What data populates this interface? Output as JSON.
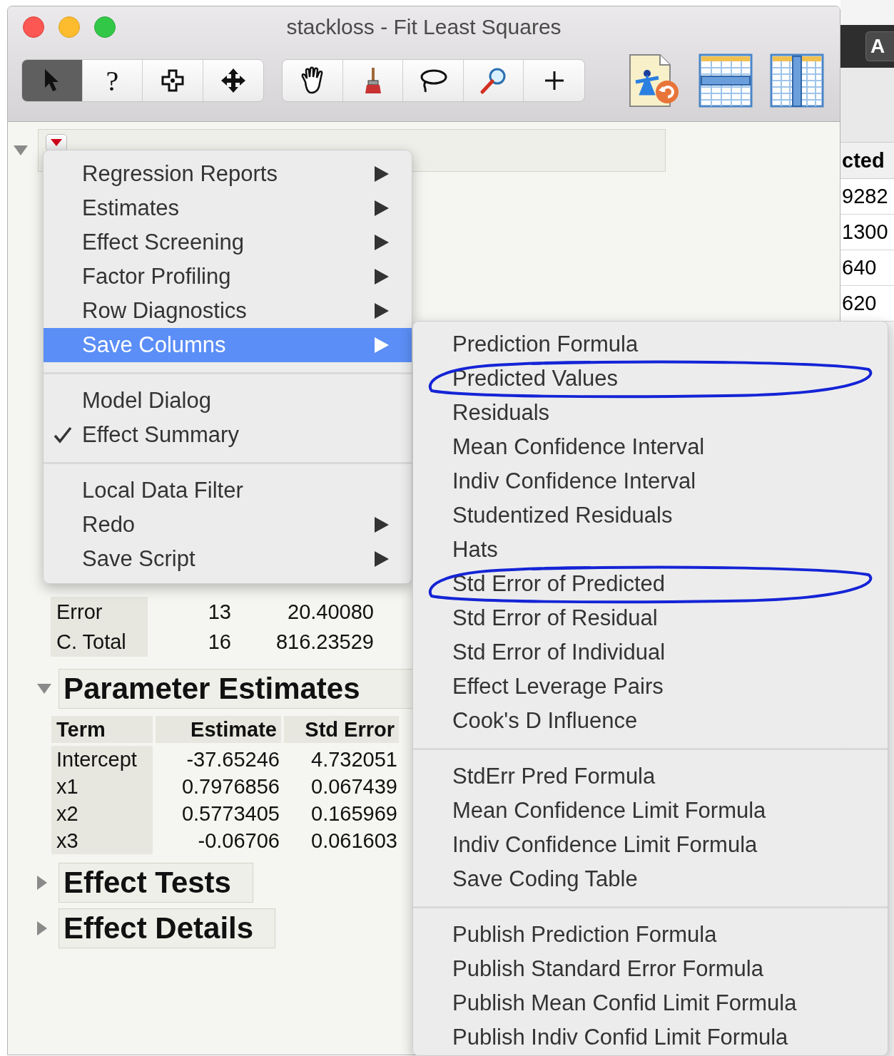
{
  "window": {
    "title": "stackloss - Fit Least Squares"
  },
  "toolbar": {
    "tool_groups": [
      {
        "tools": [
          {
            "kind": "arrow",
            "selected": true
          },
          {
            "kind": "help",
            "label": "?",
            "selected": false
          },
          {
            "kind": "crosshair",
            "selected": false
          },
          {
            "kind": "move",
            "selected": false
          }
        ]
      },
      {
        "tools": [
          {
            "kind": "hand",
            "selected": false
          },
          {
            "kind": "brush",
            "selected": false
          },
          {
            "kind": "lasso",
            "selected": false
          },
          {
            "kind": "magnifier",
            "selected": false
          },
          {
            "kind": "plus-cursor",
            "selected": false
          }
        ]
      }
    ],
    "big_buttons": [
      {
        "kind": "file"
      },
      {
        "kind": "row-table"
      },
      {
        "kind": "column-table"
      }
    ]
  },
  "report": {
    "expanded": true,
    "analysis_rows": [
      {
        "column_1": "Error",
        "column_2": "13",
        "column_3": "20.40080"
      },
      {
        "column_1": "C. Total",
        "column_2": "16",
        "column_3": "816.23529"
      }
    ],
    "sections": [
      {
        "title": "Parameter Estimates",
        "expanded": true,
        "table": {
          "columns": [
            "Term",
            "Estimate",
            "Std Error"
          ],
          "rows": [
            [
              "Intercept",
              "-37.65246",
              "4.732051"
            ],
            [
              "x1",
              "0.7976856",
              "0.067439"
            ],
            [
              "x2",
              "0.5773405",
              "0.165969"
            ],
            [
              "x3",
              "-0.06706",
              "0.061603"
            ]
          ]
        }
      },
      {
        "title": "Effect Tests",
        "expanded": false
      },
      {
        "title": "Effect Details",
        "expanded": false
      }
    ]
  },
  "menu": {
    "groups": [
      {
        "items": [
          {
            "label": "Regression Reports",
            "has_submenu": true,
            "checked": false,
            "selected": false
          },
          {
            "label": "Estimates",
            "has_submenu": true,
            "checked": false,
            "selected": false
          },
          {
            "label": "Effect Screening",
            "has_submenu": true,
            "checked": false,
            "selected": false
          },
          {
            "label": "Factor Profiling",
            "has_submenu": true,
            "checked": false,
            "selected": false
          },
          {
            "label": "Row Diagnostics",
            "has_submenu": true,
            "checked": false,
            "selected": false
          },
          {
            "label": "Save Columns",
            "has_submenu": true,
            "checked": false,
            "selected": true
          }
        ]
      },
      {
        "items": [
          {
            "label": "Model Dialog",
            "has_submenu": false,
            "checked": false,
            "selected": false
          },
          {
            "label": "Effect Summary",
            "has_submenu": false,
            "checked": true,
            "selected": false
          }
        ]
      },
      {
        "items": [
          {
            "label": "Local Data Filter",
            "has_submenu": false,
            "checked": false,
            "selected": false
          },
          {
            "label": "Redo",
            "has_submenu": true,
            "checked": false,
            "selected": false
          },
          {
            "label": "Save Script",
            "has_submenu": true,
            "checked": false,
            "selected": false
          }
        ]
      }
    ]
  },
  "submenu": {
    "groups": [
      {
        "items": [
          {
            "label": "Prediction Formula",
            "circled": false
          },
          {
            "label": "Predicted Values",
            "circled": true
          },
          {
            "label": "Residuals",
            "circled": false
          },
          {
            "label": "Mean Confidence Interval",
            "circled": false
          },
          {
            "label": "Indiv Confidence Interval",
            "circled": false
          },
          {
            "label": "Studentized Residuals",
            "circled": false
          },
          {
            "label": "Hats",
            "circled": false
          },
          {
            "label": "Std Error of Predicted",
            "circled": true
          },
          {
            "label": "Std Error of Residual",
            "circled": false
          },
          {
            "label": "Std Error of Individual",
            "circled": false
          },
          {
            "label": "Effect Leverage Pairs",
            "circled": false
          },
          {
            "label": "Cook's D Influence",
            "circled": false
          }
        ]
      },
      {
        "items": [
          {
            "label": "StdErr Pred Formula",
            "circled": false
          },
          {
            "label": "Mean Confidence Limit Formula",
            "circled": false
          },
          {
            "label": "Indiv Confidence Limit Formula",
            "circled": false
          },
          {
            "label": "Save Coding Table",
            "circled": false
          }
        ]
      },
      {
        "items": [
          {
            "label": "Publish Prediction Formula",
            "circled": false
          },
          {
            "label": "Publish Standard Error Formula",
            "circled": false
          },
          {
            "label": "Publish Mean Confid Limit Formula",
            "circled": false
          },
          {
            "label": "Publish Indiv Confid Limit Formula",
            "circled": false
          }
        ]
      }
    ]
  },
  "background_window": {
    "button": "A",
    "column_header": "cted",
    "cells": [
      "9282",
      "1300",
      "640",
      "620"
    ]
  }
}
